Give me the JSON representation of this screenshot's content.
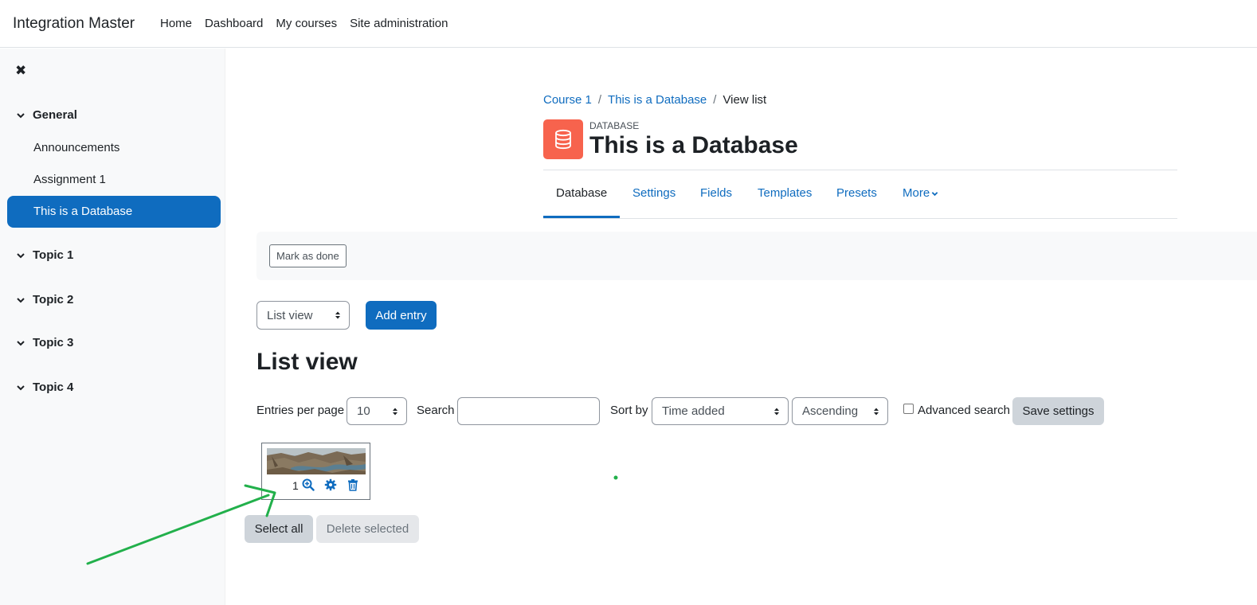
{
  "navbar": {
    "brand": "Integration Master",
    "links": [
      "Home",
      "Dashboard",
      "My courses",
      "Site administration"
    ]
  },
  "drawer": {
    "close_icon": "close-icon",
    "sections": [
      {
        "title": "General",
        "activities": [
          "Announcements",
          "Assignment 1",
          "This is a Database"
        ],
        "active_activity": "This is a Database"
      },
      {
        "title": "Topic 1"
      },
      {
        "title": "Topic 2"
      },
      {
        "title": "Topic 3"
      },
      {
        "title": "Topic 4"
      }
    ]
  },
  "breadcrumb": [
    "Course 1",
    "This is a Database",
    "View list"
  ],
  "breadcrumb_separator": "/",
  "header": {
    "module_type": "DATABASE",
    "title": "This is a Database",
    "icon": "database-icon",
    "icon_color": "#f7634d"
  },
  "tabs": {
    "items": [
      "Database",
      "Settings",
      "Fields",
      "Templates",
      "Presets",
      "More"
    ],
    "active": "Database"
  },
  "completion": {
    "mark_done_label": "Mark as done"
  },
  "actions": {
    "view_select": "List view",
    "add_entry": "Add entry"
  },
  "list_heading": "List view",
  "filters": {
    "entries_per_page_label": "Entries per page",
    "entries_per_page_value": "10",
    "search_label": "Search",
    "search_value": "",
    "sort_by_label": "Sort by",
    "sort_by_value": "Time added",
    "order_value": "Ascending",
    "advanced_search_label": "Advanced search",
    "advanced_search_checked": false,
    "save_settings": "Save settings"
  },
  "entries": [
    {
      "number": "1",
      "icons": [
        "zoom-in-icon",
        "gear-icon",
        "trash-icon"
      ]
    }
  ],
  "bulk": {
    "select_all": "Select all",
    "delete_selected": "Delete selected"
  },
  "colors": {
    "primary": "#0f6cbf",
    "annotation": "#22b04b"
  }
}
